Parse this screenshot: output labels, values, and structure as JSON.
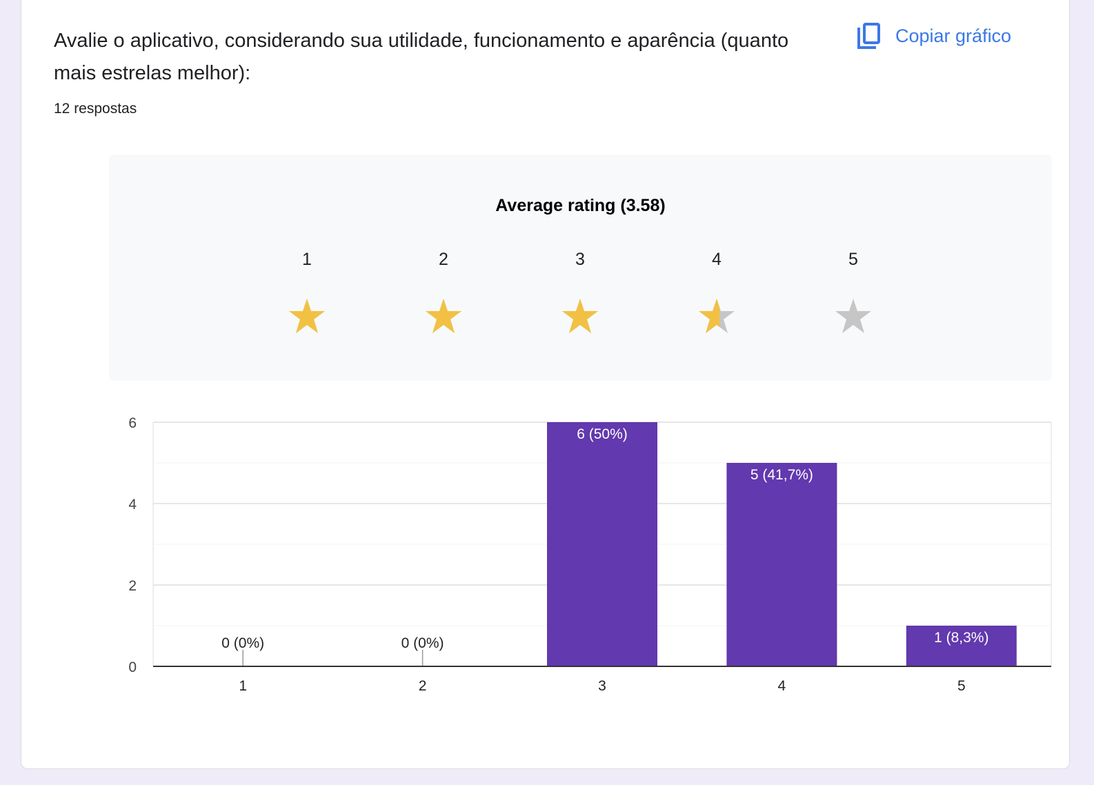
{
  "question": {
    "title": "Avalie o aplicativo, considerando sua utilidade, funcionamento e aparência (quanto mais estrelas melhor):",
    "responses": "12 respostas",
    "copy_label": "Copiar gráfico",
    "copy_icon": "copy-icon"
  },
  "rating": {
    "average_label": "Average rating (3.58)",
    "average": 3.58,
    "stars": [
      "1",
      "2",
      "3",
      "4",
      "5"
    ],
    "fill_color": "#f2c143",
    "empty_color": "#c6c6c6"
  },
  "chart_data": {
    "type": "bar",
    "categories": [
      "1",
      "2",
      "3",
      "4",
      "5"
    ],
    "values": [
      0,
      0,
      6,
      5,
      1
    ],
    "data_labels": [
      "0 (0%)",
      "0 (0%)",
      "6 (50%)",
      "5 (41,7%)",
      "1 (8,3%)"
    ],
    "ylim": [
      0,
      6
    ],
    "yticks": [
      "0",
      "2",
      "4",
      "6"
    ],
    "grid": true,
    "bar_color": "#6239ae",
    "title": "",
    "xlabel": "",
    "ylabel": ""
  }
}
